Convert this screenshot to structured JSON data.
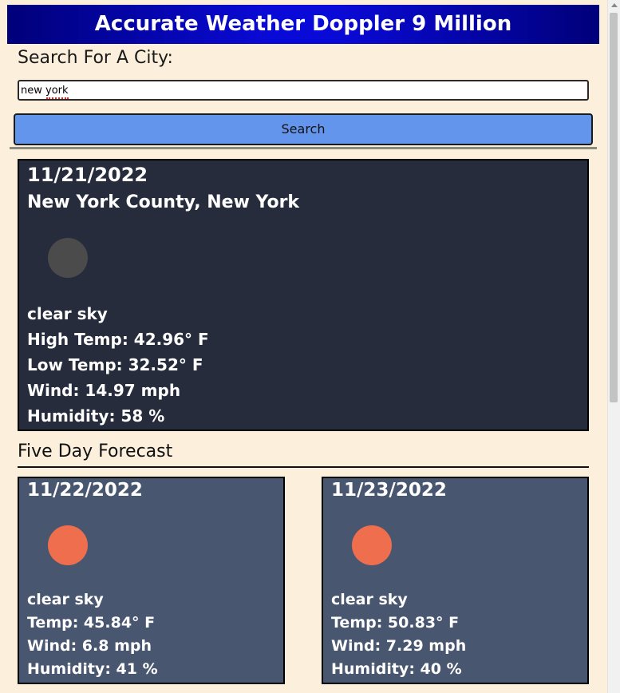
{
  "header": {
    "title": "Accurate Weather Doppler 9 Million"
  },
  "search": {
    "label": "Search For A City:",
    "value": "new york",
    "button_label": "Search"
  },
  "current": {
    "date": "11/21/2022",
    "city": "New York County, New York",
    "icon": "moon-icon",
    "description": "clear sky",
    "high": "High Temp: 42.96° F",
    "low": "Low Temp: 32.52° F",
    "wind": "Wind: 14.97 mph",
    "humidity": "Humidity: 58 %"
  },
  "forecast": {
    "title": "Five Day Forecast",
    "days": [
      {
        "date": "11/22/2022",
        "icon": "sun-icon",
        "description": "clear sky",
        "temp": "Temp: 45.84° F",
        "wind": "Wind: 6.8 mph",
        "humidity": "Humidity: 41 %"
      },
      {
        "date": "11/23/2022",
        "icon": "sun-icon",
        "description": "clear sky",
        "temp": "Temp: 50.83° F",
        "wind": "Wind: 7.29 mph",
        "humidity": "Humidity: 40 %"
      }
    ]
  },
  "colors": {
    "page_bg": "#fcf0dc",
    "header_bg": "#0a0ad8",
    "button_bg": "#6495ed",
    "current_card_bg": "#262c3b",
    "forecast_card_bg": "#485670",
    "sun_color": "#ee6e4d",
    "moon_color": "#4b4b4b"
  }
}
